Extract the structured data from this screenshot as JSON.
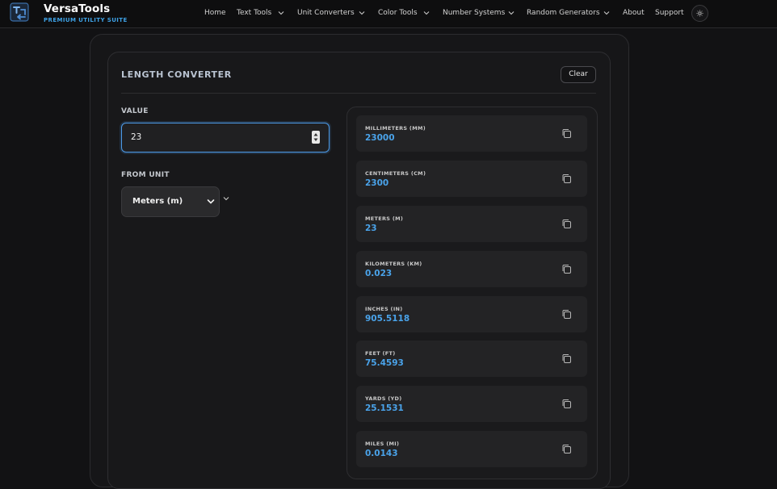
{
  "brand": {
    "name": "VersaTools",
    "tagline": "PREMIUM UTILITY SUITE",
    "logo_icon": "swap-arrows-icon"
  },
  "nav": {
    "items": [
      {
        "label": "Home",
        "dropdown": false
      },
      {
        "label": "Text Tools",
        "dropdown": true
      },
      {
        "label": "Unit Converters",
        "dropdown": true
      },
      {
        "label": "Color Tools",
        "dropdown": true
      },
      {
        "label": "Number Systems",
        "dropdown": true
      },
      {
        "label": "Random Generators",
        "dropdown": true
      },
      {
        "label": "About",
        "dropdown": false
      },
      {
        "label": "Support",
        "dropdown": false
      }
    ],
    "theme_icon": "sun-icon"
  },
  "converter": {
    "title": "LENGTH CONVERTER",
    "clear_label": "Clear",
    "value_label": "VALUE",
    "value": "23",
    "from_unit_label": "FROM UNIT",
    "from_unit_value": "Meters (m)",
    "results": [
      {
        "label": "MILLIMETERS (MM)",
        "value": "23000"
      },
      {
        "label": "CENTIMETERS (CM)",
        "value": "2300"
      },
      {
        "label": "METERS (M)",
        "value": "23"
      },
      {
        "label": "KILOMETERS (KM)",
        "value": "0.023"
      },
      {
        "label": "INCHES (IN)",
        "value": "905.5118"
      },
      {
        "label": "FEET (FT)",
        "value": "75.4593"
      },
      {
        "label": "YARDS (YD)",
        "value": "25.1531"
      },
      {
        "label": "MILES (MI)",
        "value": "0.0143"
      }
    ]
  },
  "colors": {
    "accent": "#4aa3ea",
    "tagline": "#3ea2e6",
    "background": "#121214"
  }
}
